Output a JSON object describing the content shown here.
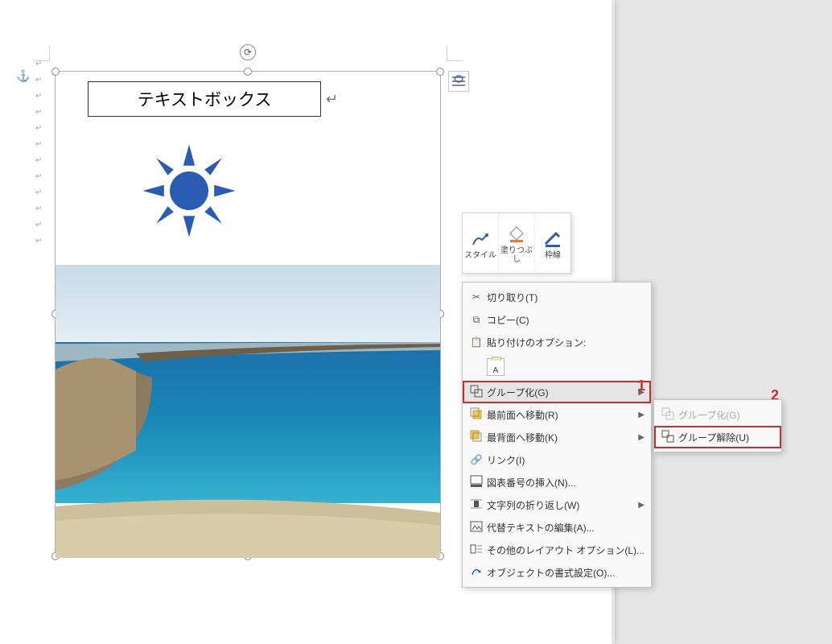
{
  "document": {
    "textbox_label": "テキストボックス",
    "anchor_icon": "⚓"
  },
  "mini_toolbar": {
    "style": "スタイル",
    "fill": "塗りつぶし",
    "outline": "枠線"
  },
  "context_menu": {
    "cut": "切り取り(T)",
    "copy": "コピー(C)",
    "paste_options_header": "貼り付けのオプション:",
    "paste_opt_a": "A",
    "group": "グループ化(G)",
    "bring_front": "最前面へ移動(R)",
    "send_back": "最背面へ移動(K)",
    "link": "リンク(I)",
    "insert_caption": "図表番号の挿入(N)...",
    "wrap_text": "文字列の折り返し(W)",
    "alt_text": "代替テキストの編集(A)...",
    "more_layout": "その他のレイアウト オプション(L)...",
    "format_object": "オブジェクトの書式設定(O)..."
  },
  "submenu": {
    "group": "グループ化(G)",
    "ungroup": "グループ解除(U)"
  },
  "callouts": {
    "one": "1",
    "two": "2"
  }
}
